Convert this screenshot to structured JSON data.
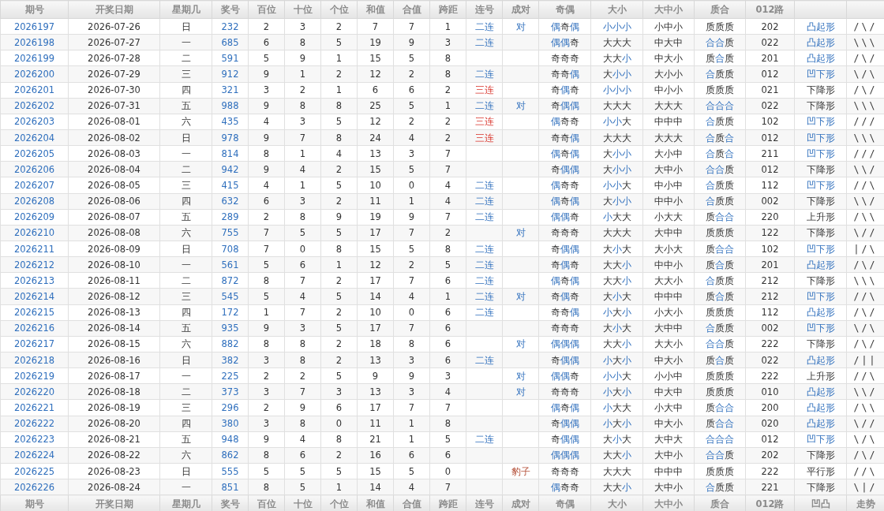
{
  "header": [
    "期号",
    "开奖日期",
    "星期几",
    "奖号",
    "百位",
    "十位",
    "个位",
    "和值",
    "合值",
    "跨距",
    "连号",
    "成对",
    "奇偶",
    "大小",
    "大中小",
    "质合",
    "012路"
  ],
  "footer": [
    "期号",
    "开奖日期",
    "星期几",
    "奖号",
    "百位",
    "十位",
    "个位",
    "和值",
    "合值",
    "跨距",
    "连号",
    "成对",
    "奇偶",
    "大小",
    "大中小",
    "质合",
    "012路",
    "凹凸",
    "走势"
  ],
  "rows": [
    {
      "period": "2026197",
      "date": "2026-07-26",
      "weekday": "日",
      "number": "232",
      "hundreds": "2",
      "tens": "3",
      "units": "2",
      "sum": "7",
      "sum_tail": "7",
      "span": "1",
      "run": {
        "text": "二连",
        "kind": "double"
      },
      "pair": {
        "text": "对",
        "kind": "pair"
      },
      "odd_even": "偶奇偶",
      "odd_even_marks": [
        true,
        false,
        true
      ],
      "big_small": "小小小",
      "big_small_marks": [
        true,
        true,
        true
      ],
      "big_mid_small": "小中小",
      "prime_composite": "质质质",
      "prime_composite_marks": [
        false,
        false,
        false
      ],
      "route_012": "202",
      "shape": "凸起形",
      "shape_marked": true,
      "trend": "/\\/"
    },
    {
      "period": "2026198",
      "date": "2026-07-27",
      "weekday": "一",
      "number": "685",
      "hundreds": "6",
      "tens": "8",
      "units": "5",
      "sum": "19",
      "sum_tail": "9",
      "span": "3",
      "run": {
        "text": "二连",
        "kind": "double"
      },
      "odd_even": "偶偶奇",
      "odd_even_marks": [
        true,
        true,
        false
      ],
      "big_small": "大大大",
      "big_small_marks": [
        false,
        false,
        false
      ],
      "big_mid_small": "中大中",
      "prime_composite": "合合质",
      "prime_composite_marks": [
        true,
        true,
        false
      ],
      "route_012": "022",
      "shape": "凸起形",
      "shape_marked": true,
      "trend": "\\\\\\"
    },
    {
      "period": "2026199",
      "date": "2026-07-28",
      "weekday": "二",
      "number": "591",
      "hundreds": "5",
      "tens": "9",
      "units": "1",
      "sum": "15",
      "sum_tail": "5",
      "span": "8",
      "odd_even": "奇奇奇",
      "odd_even_marks": [
        false,
        false,
        false
      ],
      "big_small": "大大小",
      "big_small_marks": [
        false,
        false,
        true
      ],
      "big_mid_small": "中大小",
      "prime_composite": "质合质",
      "prime_composite_marks": [
        false,
        true,
        false
      ],
      "route_012": "201",
      "shape": "凸起形",
      "shape_marked": true,
      "trend": "/\\/"
    },
    {
      "period": "2026200",
      "date": "2026-07-29",
      "weekday": "三",
      "number": "912",
      "hundreds": "9",
      "tens": "1",
      "units": "2",
      "sum": "12",
      "sum_tail": "2",
      "span": "8",
      "run": {
        "text": "二连",
        "kind": "double"
      },
      "odd_even": "奇奇偶",
      "odd_even_marks": [
        false,
        false,
        true
      ],
      "big_small": "大小小",
      "big_small_marks": [
        false,
        true,
        true
      ],
      "big_mid_small": "大小小",
      "prime_composite": "合质质",
      "prime_composite_marks": [
        true,
        false,
        false
      ],
      "route_012": "012",
      "shape": "凹下形",
      "shape_marked": true,
      "trend": "\\/\\"
    },
    {
      "period": "2026201",
      "date": "2026-07-30",
      "weekday": "四",
      "number": "321",
      "hundreds": "3",
      "tens": "2",
      "units": "1",
      "sum": "6",
      "sum_tail": "6",
      "span": "2",
      "run": {
        "text": "三连",
        "kind": "triple"
      },
      "odd_even": "奇偶奇",
      "odd_even_marks": [
        false,
        true,
        false
      ],
      "big_small": "小小小",
      "big_small_marks": [
        true,
        true,
        true
      ],
      "big_mid_small": "中小小",
      "prime_composite": "质质质",
      "prime_composite_marks": [
        false,
        false,
        false
      ],
      "route_012": "021",
      "shape": "下降形",
      "shape_marked": false,
      "trend": "/\\/"
    },
    {
      "period": "2026202",
      "date": "2026-07-31",
      "weekday": "五",
      "number": "988",
      "hundreds": "9",
      "tens": "8",
      "units": "8",
      "sum": "25",
      "sum_tail": "5",
      "span": "1",
      "run": {
        "text": "二连",
        "kind": "double"
      },
      "pair": {
        "text": "对",
        "kind": "pair"
      },
      "odd_even": "奇偶偶",
      "odd_even_marks": [
        false,
        true,
        true
      ],
      "big_small": "大大大",
      "big_small_marks": [
        false,
        false,
        false
      ],
      "big_mid_small": "大大大",
      "prime_composite": "合合合",
      "prime_composite_marks": [
        true,
        true,
        true
      ],
      "route_012": "022",
      "shape": "下降形",
      "shape_marked": false,
      "trend": "\\\\\\"
    },
    {
      "period": "2026203",
      "date": "2026-08-01",
      "weekday": "六",
      "number": "435",
      "hundreds": "4",
      "tens": "3",
      "units": "5",
      "sum": "12",
      "sum_tail": "2",
      "span": "2",
      "run": {
        "text": "三连",
        "kind": "triple"
      },
      "odd_even": "偶奇奇",
      "odd_even_marks": [
        true,
        false,
        false
      ],
      "big_small": "小小大",
      "big_small_marks": [
        true,
        true,
        false
      ],
      "big_mid_small": "中中中",
      "prime_composite": "合质质",
      "prime_composite_marks": [
        true,
        false,
        false
      ],
      "route_012": "102",
      "shape": "凹下形",
      "shape_marked": true,
      "trend": "///"
    },
    {
      "period": "2026204",
      "date": "2026-08-02",
      "weekday": "日",
      "number": "978",
      "hundreds": "9",
      "tens": "7",
      "units": "8",
      "sum": "24",
      "sum_tail": "4",
      "span": "2",
      "run": {
        "text": "三连",
        "kind": "triple"
      },
      "odd_even": "奇奇偶",
      "odd_even_marks": [
        false,
        false,
        true
      ],
      "big_small": "大大大",
      "big_small_marks": [
        false,
        false,
        false
      ],
      "big_mid_small": "大大大",
      "prime_composite": "合质合",
      "prime_composite_marks": [
        true,
        false,
        true
      ],
      "route_012": "012",
      "shape": "凹下形",
      "shape_marked": true,
      "trend": "\\\\\\"
    },
    {
      "period": "2026205",
      "date": "2026-08-03",
      "weekday": "一",
      "number": "814",
      "hundreds": "8",
      "tens": "1",
      "units": "4",
      "sum": "13",
      "sum_tail": "3",
      "span": "7",
      "odd_even": "偶奇偶",
      "odd_even_marks": [
        true,
        false,
        true
      ],
      "big_small": "大小小",
      "big_small_marks": [
        false,
        true,
        true
      ],
      "big_mid_small": "大小中",
      "prime_composite": "合质合",
      "prime_composite_marks": [
        true,
        false,
        true
      ],
      "route_012": "211",
      "shape": "凹下形",
      "shape_marked": true,
      "trend": "///"
    },
    {
      "period": "2026206",
      "date": "2026-08-04",
      "weekday": "二",
      "number": "942",
      "hundreds": "9",
      "tens": "4",
      "units": "2",
      "sum": "15",
      "sum_tail": "5",
      "span": "7",
      "odd_even": "奇偶偶",
      "odd_even_marks": [
        false,
        true,
        true
      ],
      "big_small": "大小小",
      "big_small_marks": [
        false,
        true,
        true
      ],
      "big_mid_small": "大中小",
      "prime_composite": "合合质",
      "prime_composite_marks": [
        true,
        true,
        false
      ],
      "route_012": "012",
      "shape": "下降形",
      "shape_marked": false,
      "trend": "\\\\/"
    },
    {
      "period": "2026207",
      "date": "2026-08-05",
      "weekday": "三",
      "number": "415",
      "hundreds": "4",
      "tens": "1",
      "units": "5",
      "sum": "10",
      "sum_tail": "0",
      "span": "4",
      "run": {
        "text": "二连",
        "kind": "double"
      },
      "odd_even": "偶奇奇",
      "odd_even_marks": [
        true,
        false,
        false
      ],
      "big_small": "小小大",
      "big_small_marks": [
        true,
        true,
        false
      ],
      "big_mid_small": "中小中",
      "prime_composite": "合质质",
      "prime_composite_marks": [
        true,
        false,
        false
      ],
      "route_012": "112",
      "shape": "凹下形",
      "shape_marked": true,
      "trend": "//\\"
    },
    {
      "period": "2026208",
      "date": "2026-08-06",
      "weekday": "四",
      "number": "632",
      "hundreds": "6",
      "tens": "3",
      "units": "2",
      "sum": "11",
      "sum_tail": "1",
      "span": "4",
      "run": {
        "text": "二连",
        "kind": "double"
      },
      "odd_even": "偶奇偶",
      "odd_even_marks": [
        true,
        false,
        true
      ],
      "big_small": "大小小",
      "big_small_marks": [
        false,
        true,
        true
      ],
      "big_mid_small": "中中小",
      "prime_composite": "合质质",
      "prime_composite_marks": [
        true,
        false,
        false
      ],
      "route_012": "002",
      "shape": "下降形",
      "shape_marked": false,
      "trend": "\\\\/"
    },
    {
      "period": "2026209",
      "date": "2026-08-07",
      "weekday": "五",
      "number": "289",
      "hundreds": "2",
      "tens": "8",
      "units": "9",
      "sum": "19",
      "sum_tail": "9",
      "span": "7",
      "run": {
        "text": "二连",
        "kind": "double"
      },
      "odd_even": "偶偶奇",
      "odd_even_marks": [
        true,
        true,
        false
      ],
      "big_small": "小大大",
      "big_small_marks": [
        true,
        false,
        false
      ],
      "big_mid_small": "小大大",
      "prime_composite": "质合合",
      "prime_composite_marks": [
        false,
        true,
        true
      ],
      "route_012": "220",
      "shape": "上升形",
      "shape_marked": false,
      "trend": "/\\\\"
    },
    {
      "period": "2026210",
      "date": "2026-08-08",
      "weekday": "六",
      "number": "755",
      "hundreds": "7",
      "tens": "5",
      "units": "5",
      "sum": "17",
      "sum_tail": "7",
      "span": "2",
      "pair": {
        "text": "对",
        "kind": "pair"
      },
      "odd_even": "奇奇奇",
      "odd_even_marks": [
        false,
        false,
        false
      ],
      "big_small": "大大大",
      "big_small_marks": [
        false,
        false,
        false
      ],
      "big_mid_small": "大中中",
      "prime_composite": "质质质",
      "prime_composite_marks": [
        false,
        false,
        false
      ],
      "route_012": "122",
      "shape": "下降形",
      "shape_marked": false,
      "trend": "\\//"
    },
    {
      "period": "2026211",
      "date": "2026-08-09",
      "weekday": "日",
      "number": "708",
      "hundreds": "7",
      "tens": "0",
      "units": "8",
      "sum": "15",
      "sum_tail": "5",
      "span": "8",
      "run": {
        "text": "二连",
        "kind": "double"
      },
      "odd_even": "奇偶偶",
      "odd_even_marks": [
        false,
        true,
        true
      ],
      "big_small": "大小大",
      "big_small_marks": [
        false,
        true,
        false
      ],
      "big_mid_small": "大小大",
      "prime_composite": "质合合",
      "prime_composite_marks": [
        false,
        true,
        true
      ],
      "route_012": "102",
      "shape": "凹下形",
      "shape_marked": true,
      "trend": "|/\\"
    },
    {
      "period": "2026212",
      "date": "2026-08-10",
      "weekday": "一",
      "number": "561",
      "hundreds": "5",
      "tens": "6",
      "units": "1",
      "sum": "12",
      "sum_tail": "2",
      "span": "5",
      "run": {
        "text": "二连",
        "kind": "double"
      },
      "odd_even": "奇偶奇",
      "odd_even_marks": [
        false,
        true,
        false
      ],
      "big_small": "大大小",
      "big_small_marks": [
        false,
        false,
        true
      ],
      "big_mid_small": "中中小",
      "prime_composite": "质合质",
      "prime_composite_marks": [
        false,
        true,
        false
      ],
      "route_012": "201",
      "shape": "凸起形",
      "shape_marked": true,
      "trend": "/\\/"
    },
    {
      "period": "2026213",
      "date": "2026-08-11",
      "weekday": "二",
      "number": "872",
      "hundreds": "8",
      "tens": "7",
      "units": "2",
      "sum": "17",
      "sum_tail": "7",
      "span": "6",
      "run": {
        "text": "二连",
        "kind": "double"
      },
      "odd_even": "偶奇偶",
      "odd_even_marks": [
        true,
        false,
        true
      ],
      "big_small": "大大小",
      "big_small_marks": [
        false,
        false,
        true
      ],
      "big_mid_small": "大大小",
      "prime_composite": "合质质",
      "prime_composite_marks": [
        true,
        false,
        false
      ],
      "route_012": "212",
      "shape": "下降形",
      "shape_marked": false,
      "trend": "\\\\\\"
    },
    {
      "period": "2026214",
      "date": "2026-08-12",
      "weekday": "三",
      "number": "545",
      "hundreds": "5",
      "tens": "4",
      "units": "5",
      "sum": "14",
      "sum_tail": "4",
      "span": "1",
      "run": {
        "text": "二连",
        "kind": "double"
      },
      "pair": {
        "text": "对",
        "kind": "pair"
      },
      "odd_even": "奇偶奇",
      "odd_even_marks": [
        false,
        true,
        false
      ],
      "big_small": "大小大",
      "big_small_marks": [
        false,
        true,
        false
      ],
      "big_mid_small": "中中中",
      "prime_composite": "质合质",
      "prime_composite_marks": [
        false,
        true,
        false
      ],
      "route_012": "212",
      "shape": "凹下形",
      "shape_marked": true,
      "trend": "//\\"
    },
    {
      "period": "2026215",
      "date": "2026-08-13",
      "weekday": "四",
      "number": "172",
      "hundreds": "1",
      "tens": "7",
      "units": "2",
      "sum": "10",
      "sum_tail": "0",
      "span": "6",
      "run": {
        "text": "二连",
        "kind": "double"
      },
      "odd_even": "奇奇偶",
      "odd_even_marks": [
        false,
        false,
        true
      ],
      "big_small": "小大小",
      "big_small_marks": [
        true,
        false,
        true
      ],
      "big_mid_small": "小大小",
      "prime_composite": "质质质",
      "prime_composite_marks": [
        false,
        false,
        false
      ],
      "route_012": "112",
      "shape": "凸起形",
      "shape_marked": true,
      "trend": "/\\/"
    },
    {
      "period": "2026216",
      "date": "2026-08-14",
      "weekday": "五",
      "number": "935",
      "hundreds": "9",
      "tens": "3",
      "units": "5",
      "sum": "17",
      "sum_tail": "7",
      "span": "6",
      "odd_even": "奇奇奇",
      "odd_even_marks": [
        false,
        false,
        false
      ],
      "big_small": "大小大",
      "big_small_marks": [
        false,
        true,
        false
      ],
      "big_mid_small": "大中中",
      "prime_composite": "合质质",
      "prime_composite_marks": [
        true,
        false,
        false
      ],
      "route_012": "002",
      "shape": "凹下形",
      "shape_marked": true,
      "trend": "\\/\\"
    },
    {
      "period": "2026217",
      "date": "2026-08-15",
      "weekday": "六",
      "number": "882",
      "hundreds": "8",
      "tens": "8",
      "units": "2",
      "sum": "18",
      "sum_tail": "8",
      "span": "6",
      "pair": {
        "text": "对",
        "kind": "pair"
      },
      "odd_even": "偶偶偶",
      "odd_even_marks": [
        true,
        true,
        true
      ],
      "big_small": "大大小",
      "big_small_marks": [
        false,
        false,
        true
      ],
      "big_mid_small": "大大小",
      "prime_composite": "合合质",
      "prime_composite_marks": [
        true,
        true,
        false
      ],
      "route_012": "222",
      "shape": "下降形",
      "shape_marked": false,
      "trend": "/\\/"
    },
    {
      "period": "2026218",
      "date": "2026-08-16",
      "weekday": "日",
      "number": "382",
      "hundreds": "3",
      "tens": "8",
      "units": "2",
      "sum": "13",
      "sum_tail": "3",
      "span": "6",
      "run": {
        "text": "二连",
        "kind": "double"
      },
      "odd_even": "奇偶偶",
      "odd_even_marks": [
        false,
        true,
        true
      ],
      "big_small": "小大小",
      "big_small_marks": [
        true,
        false,
        true
      ],
      "big_mid_small": "中大小",
      "prime_composite": "质合质",
      "prime_composite_marks": [
        false,
        true,
        false
      ],
      "route_012": "022",
      "shape": "凸起形",
      "shape_marked": true,
      "trend": "/||"
    },
    {
      "period": "2026219",
      "date": "2026-08-17",
      "weekday": "一",
      "number": "225",
      "hundreds": "2",
      "tens": "2",
      "units": "5",
      "sum": "9",
      "sum_tail": "9",
      "span": "3",
      "pair": {
        "text": "对",
        "kind": "pair"
      },
      "odd_even": "偶偶奇",
      "odd_even_marks": [
        true,
        true,
        false
      ],
      "big_small": "小小大",
      "big_small_marks": [
        true,
        true,
        false
      ],
      "big_mid_small": "小小中",
      "prime_composite": "质质质",
      "prime_composite_marks": [
        false,
        false,
        false
      ],
      "route_012": "222",
      "shape": "上升形",
      "shape_marked": false,
      "trend": "//\\"
    },
    {
      "period": "2026220",
      "date": "2026-08-18",
      "weekday": "二",
      "number": "373",
      "hundreds": "3",
      "tens": "7",
      "units": "3",
      "sum": "13",
      "sum_tail": "3",
      "span": "4",
      "pair": {
        "text": "对",
        "kind": "pair"
      },
      "odd_even": "奇奇奇",
      "odd_even_marks": [
        false,
        false,
        false
      ],
      "big_small": "小大小",
      "big_small_marks": [
        true,
        false,
        true
      ],
      "big_mid_small": "中大中",
      "prime_composite": "质质质",
      "prime_composite_marks": [
        false,
        false,
        false
      ],
      "route_012": "010",
      "shape": "凸起形",
      "shape_marked": true,
      "trend": "\\\\/"
    },
    {
      "period": "2026221",
      "date": "2026-08-19",
      "weekday": "三",
      "number": "296",
      "hundreds": "2",
      "tens": "9",
      "units": "6",
      "sum": "17",
      "sum_tail": "7",
      "span": "7",
      "odd_even": "偶奇偶",
      "odd_even_marks": [
        true,
        false,
        true
      ],
      "big_small": "小大大",
      "big_small_marks": [
        true,
        false,
        false
      ],
      "big_mid_small": "小大中",
      "prime_composite": "质合合",
      "prime_composite_marks": [
        false,
        true,
        true
      ],
      "route_012": "200",
      "shape": "凸起形",
      "shape_marked": true,
      "trend": "/\\\\"
    },
    {
      "period": "2026222",
      "date": "2026-08-20",
      "weekday": "四",
      "number": "380",
      "hundreds": "3",
      "tens": "8",
      "units": "0",
      "sum": "11",
      "sum_tail": "1",
      "span": "8",
      "odd_even": "奇偶偶",
      "odd_even_marks": [
        false,
        true,
        true
      ],
      "big_small": "小大小",
      "big_small_marks": [
        true,
        false,
        true
      ],
      "big_mid_small": "中大小",
      "prime_composite": "质合合",
      "prime_composite_marks": [
        false,
        true,
        true
      ],
      "route_012": "020",
      "shape": "凸起形",
      "shape_marked": true,
      "trend": "\\//"
    },
    {
      "period": "2026223",
      "date": "2026-08-21",
      "weekday": "五",
      "number": "948",
      "hundreds": "9",
      "tens": "4",
      "units": "8",
      "sum": "21",
      "sum_tail": "1",
      "span": "5",
      "run": {
        "text": "二连",
        "kind": "double"
      },
      "odd_even": "奇偶偶",
      "odd_even_marks": [
        false,
        true,
        true
      ],
      "big_small": "大小大",
      "big_small_marks": [
        false,
        true,
        false
      ],
      "big_mid_small": "大中大",
      "prime_composite": "合合合",
      "prime_composite_marks": [
        true,
        true,
        true
      ],
      "route_012": "012",
      "shape": "凹下形",
      "shape_marked": true,
      "trend": "\\/\\"
    },
    {
      "period": "2026224",
      "date": "2026-08-22",
      "weekday": "六",
      "number": "862",
      "hundreds": "8",
      "tens": "6",
      "units": "2",
      "sum": "16",
      "sum_tail": "6",
      "span": "6",
      "odd_even": "偶偶偶",
      "odd_even_marks": [
        true,
        true,
        true
      ],
      "big_small": "大大小",
      "big_small_marks": [
        false,
        false,
        true
      ],
      "big_mid_small": "大中小",
      "prime_composite": "合合质",
      "prime_composite_marks": [
        true,
        true,
        false
      ],
      "route_012": "202",
      "shape": "下降形",
      "shape_marked": false,
      "trend": "/\\/"
    },
    {
      "period": "2026225",
      "date": "2026-08-23",
      "weekday": "日",
      "number": "555",
      "hundreds": "5",
      "tens": "5",
      "units": "5",
      "sum": "15",
      "sum_tail": "5",
      "span": "0",
      "pair": {
        "text": "豹子",
        "kind": "leopard"
      },
      "odd_even": "奇奇奇",
      "odd_even_marks": [
        false,
        false,
        false
      ],
      "big_small": "大大大",
      "big_small_marks": [
        false,
        false,
        false
      ],
      "big_mid_small": "中中中",
      "prime_composite": "质质质",
      "prime_composite_marks": [
        false,
        false,
        false
      ],
      "route_012": "222",
      "shape": "平行形",
      "shape_marked": false,
      "trend": "//\\"
    },
    {
      "period": "2026226",
      "date": "2026-08-24",
      "weekday": "一",
      "number": "851",
      "hundreds": "8",
      "tens": "5",
      "units": "1",
      "sum": "14",
      "sum_tail": "4",
      "span": "7",
      "odd_even": "偶奇奇",
      "odd_even_marks": [
        true,
        false,
        false
      ],
      "big_small": "大大小",
      "big_small_marks": [
        false,
        false,
        true
      ],
      "big_mid_small": "大中小",
      "prime_composite": "合质质",
      "prime_composite_marks": [
        true,
        false,
        false
      ],
      "route_012": "221",
      "shape": "下降形",
      "shape_marked": false,
      "trend": "\\|/"
    }
  ]
}
